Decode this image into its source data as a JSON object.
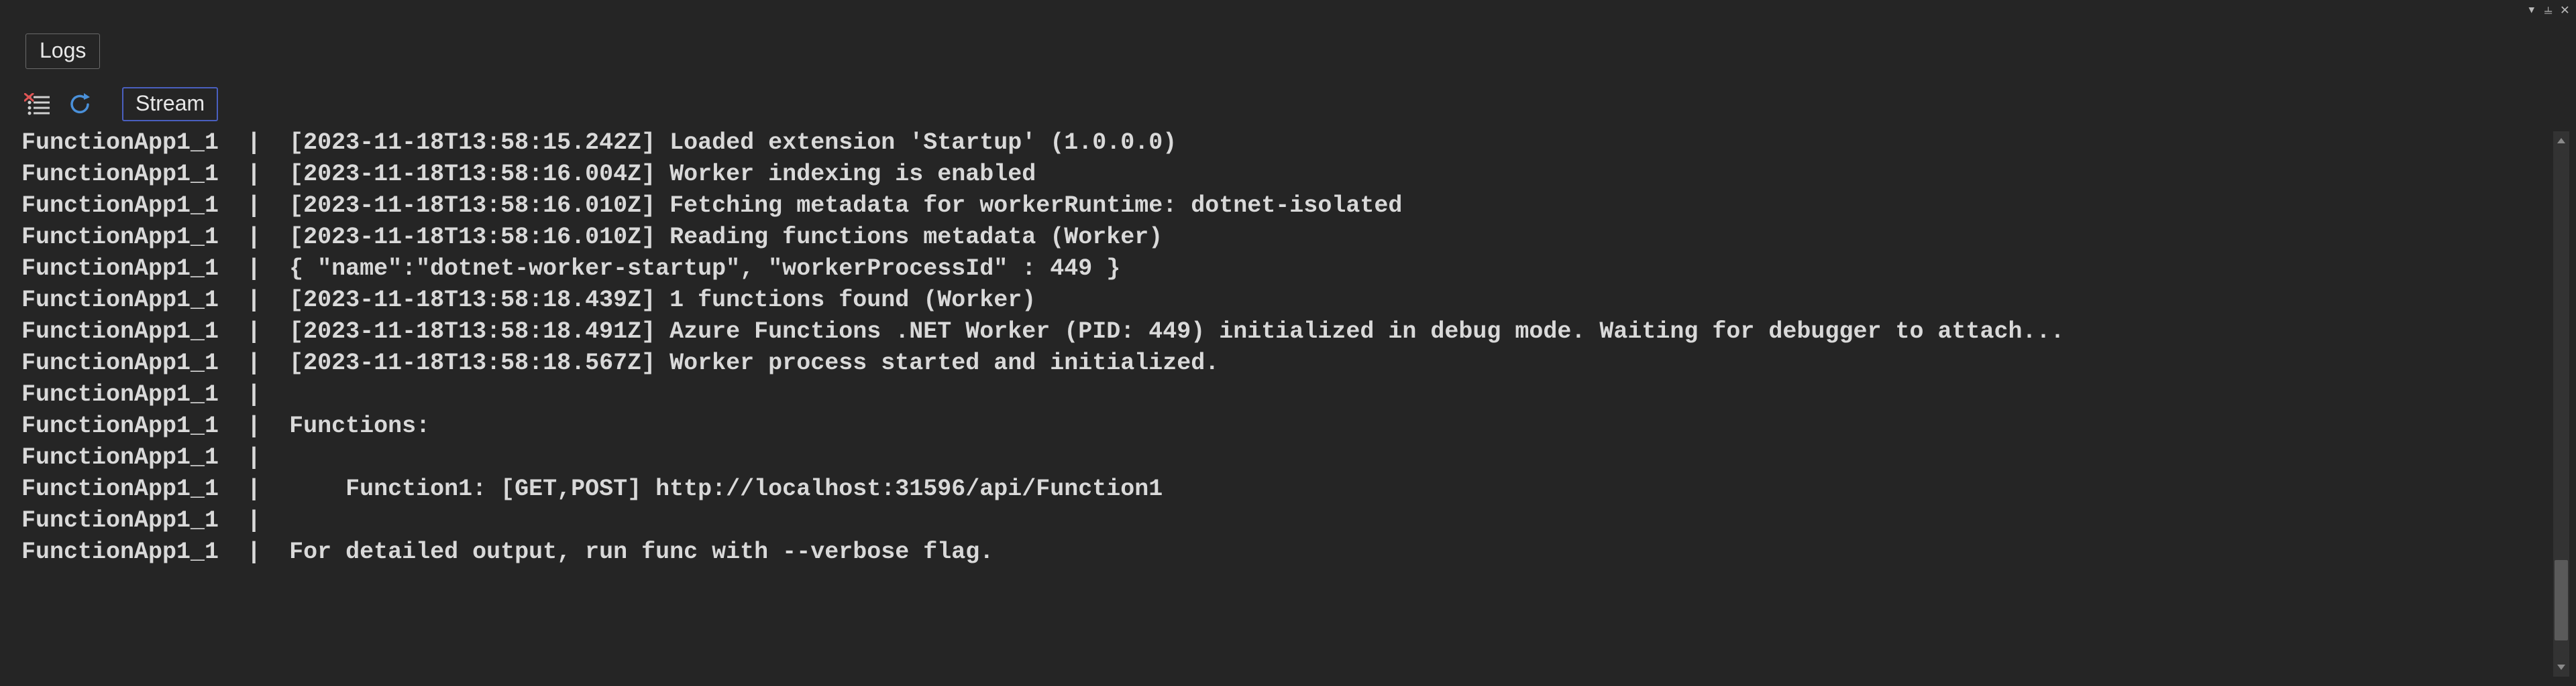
{
  "window": {
    "dropdown_glyph": "▾",
    "pin_glyph": "⫨",
    "close_glyph": "✕"
  },
  "tab": {
    "label": "Logs"
  },
  "toolbar": {
    "stream_label": "Stream"
  },
  "log": {
    "prefix": "FunctionApp1_1  |  ",
    "lines": [
      "[2023-11-18T13:58:15.242Z] Loaded extension 'Startup' (1.0.0.0)",
      "[2023-11-18T13:58:16.004Z] Worker indexing is enabled",
      "[2023-11-18T13:58:16.010Z] Fetching metadata for workerRuntime: dotnet-isolated",
      "[2023-11-18T13:58:16.010Z] Reading functions metadata (Worker)",
      "{ \"name\":\"dotnet-worker-startup\", \"workerProcessId\" : 449 }",
      "[2023-11-18T13:58:18.439Z] 1 functions found (Worker)",
      "[2023-11-18T13:58:18.491Z] Azure Functions .NET Worker (PID: 449) initialized in debug mode. Waiting for debugger to attach...",
      "[2023-11-18T13:58:18.567Z] Worker process started and initialized.",
      "",
      "Functions:",
      "",
      "    Function1: [GET,POST] http://localhost:31596/api/Function1",
      "",
      "For detailed output, run func with --verbose flag."
    ]
  }
}
